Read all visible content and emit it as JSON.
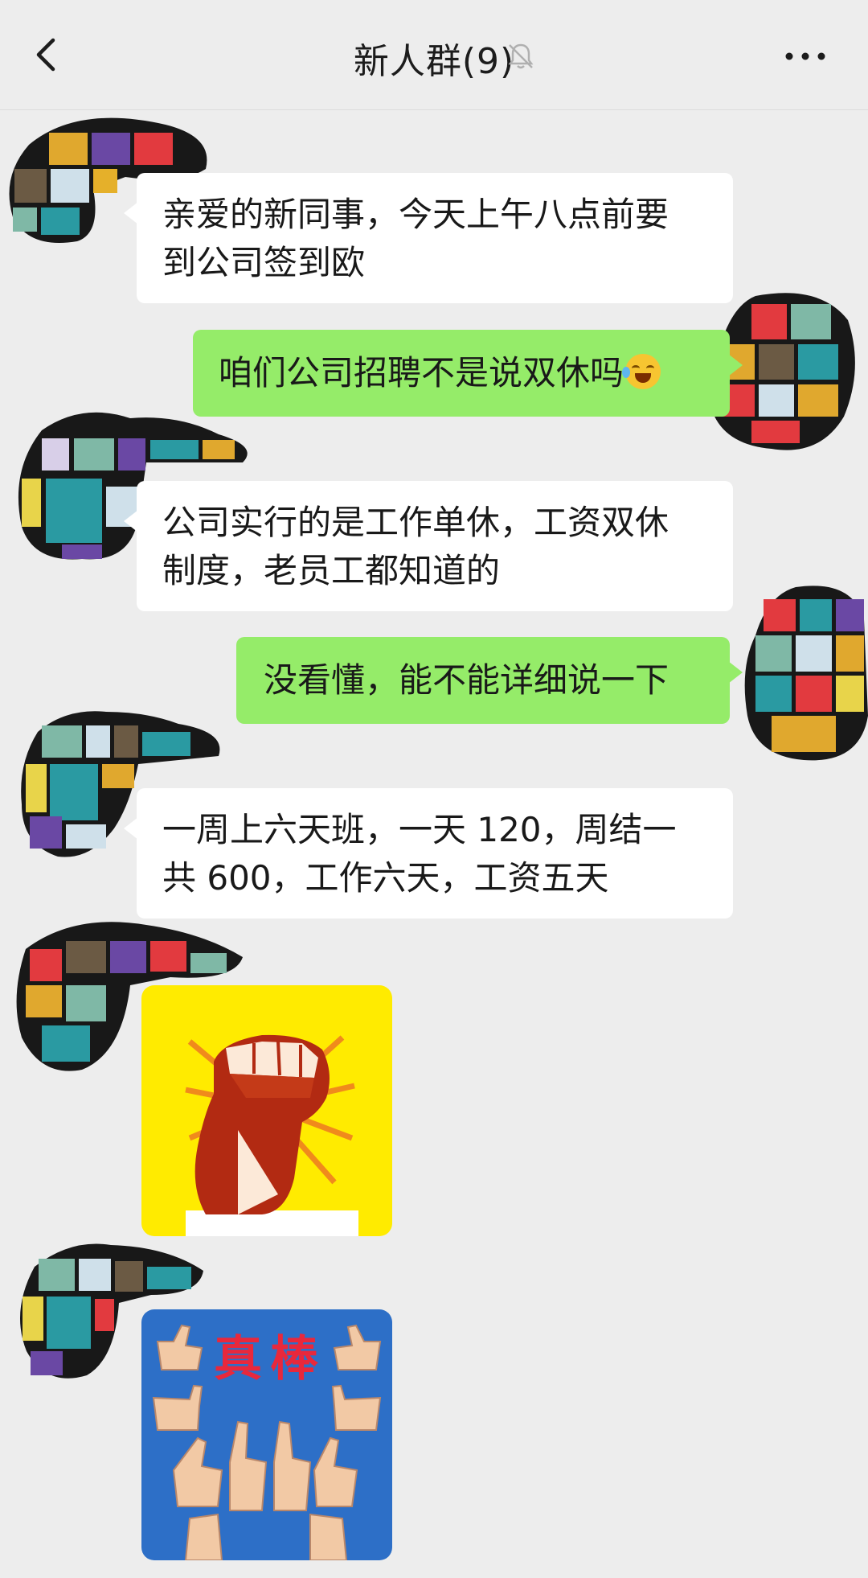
{
  "header": {
    "title": "新人群(9)",
    "back_icon": "chevron-left-icon",
    "mute_icon": "bell-off-icon",
    "more_icon": "more-dots-icon"
  },
  "messages": [
    {
      "side": "left",
      "text_line1": "亲爱的新同事，今天上午八点前要",
      "text_line2": "到公司签到欧"
    },
    {
      "side": "right",
      "text": "咱们公司招聘不是说双休吗",
      "emoji": "grimace-sweat-emoji"
    },
    {
      "side": "left",
      "text_line1": "公司实行的是工作单休，工资双休",
      "text_line2": "制度，老员工都知道的"
    },
    {
      "side": "right",
      "text": "没看懂，能不能详细说一下"
    },
    {
      "side": "left",
      "text_line1": "一周上六天班，一天 120，周结一",
      "text_line2": "共 600，工作六天，工资五天"
    },
    {
      "side": "left",
      "type": "sticker",
      "sticker": "raised-fist-sticker"
    },
    {
      "side": "left",
      "type": "sticker",
      "sticker": "thumbs-up-sticker",
      "caption": "真棒"
    }
  ],
  "colors": {
    "background": "#ededed",
    "bubble_left": "#ffffff",
    "bubble_right": "#95ec69",
    "sticker_fist_bg": "#ffeb00",
    "sticker_thumbs_bg": "#2d6fc7"
  }
}
